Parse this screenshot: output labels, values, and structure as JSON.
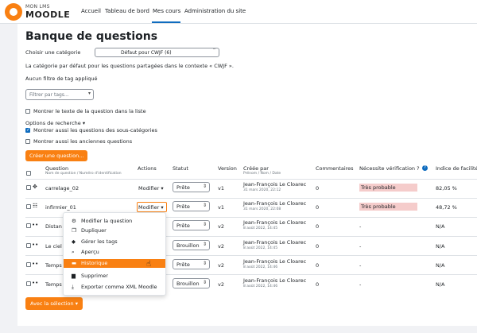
{
  "brand": {
    "top": "MON LMS",
    "main": "MOODLE",
    "accent": "#f98012"
  },
  "nav": {
    "items": [
      "Accueil",
      "Tableau de bord",
      "Mes cours",
      "Administration du site"
    ]
  },
  "page": {
    "title": "Banque de questions",
    "category_label": "Choisir une catégorie",
    "category_value": "Défaut pour CWJF (6)",
    "category_desc": "La catégorie par défaut pour les questions partagées dans le contexte « CWJF ».",
    "tag_status": "Aucun filtre de tag appliqué",
    "tag_placeholder": "Filtrer par tags...",
    "show_text": "Montrer le texte de la question dans la liste",
    "search_options": "Options de recherche",
    "show_subcats": "Montrer aussi les questions des sous-catégories",
    "show_old": "Montrer aussi les anciennes questions",
    "create_btn": "Créer une question..."
  },
  "table": {
    "headers": {
      "question": "Question",
      "question_sub": "Nom de question / Numéro d'identification",
      "actions": "Actions",
      "status": "Statut",
      "version": "Version",
      "created": "Créée par",
      "created_sub": "Prénom / Nom / Date",
      "comments": "Commentaires",
      "review": "Nécessite vérification ?",
      "facility": "Indice de facilité"
    },
    "rows": [
      {
        "icon": "✥",
        "name": "carrelage_02",
        "action": "Modifier",
        "status": "Prête",
        "version": "v1",
        "author": "Jean-François Le Cloarec",
        "date": "31 mars 2020, 22:12",
        "comments": "0",
        "review": "Très probable",
        "facility": "82,05 %"
      },
      {
        "icon": "☷",
        "name": "infirmier_01",
        "action": "Modifier",
        "status": "Prête",
        "version": "v1",
        "author": "Jean-François Le Cloarec",
        "date": "31 mars 2020, 22:08",
        "comments": "0",
        "review": "Très probable",
        "facility": "48,72 %"
      },
      {
        "icon": "••",
        "name": "Distan",
        "action": "",
        "status": "Prête",
        "version": "v2",
        "author": "Jean-François Le Cloarec",
        "date": "8 août 2022, 14:45",
        "comments": "0",
        "review": "-",
        "facility": "N/A"
      },
      {
        "icon": "••",
        "name": "Le ciel",
        "action": "",
        "status": "Brouillon",
        "version": "v2",
        "author": "Jean-François Le Cloarec",
        "date": "8 août 2022, 14:45",
        "comments": "0",
        "review": "-",
        "facility": "N/A"
      },
      {
        "icon": "••",
        "name": "Temps",
        "action": "",
        "status": "Prête",
        "version": "v2",
        "author": "Jean-François Le Cloarec",
        "date": "8 août 2022, 14:46",
        "comments": "0",
        "review": "-",
        "facility": "N/A"
      },
      {
        "icon": "••",
        "name": "Temps",
        "action": "",
        "status": "Brouillon",
        "version": "v2",
        "author": "Jean-François Le Cloarec",
        "date": "8 août 2022, 14:46",
        "comments": "0",
        "review": "-",
        "facility": "N/A"
      }
    ]
  },
  "menu": {
    "items": [
      {
        "icon": "gear-icon",
        "glyph": "⚙",
        "label": "Modifier la question"
      },
      {
        "icon": "copy-icon",
        "glyph": "❐",
        "label": "Dupliquer"
      },
      {
        "icon": "tag-icon",
        "glyph": "◆",
        "label": "Gérer les tags"
      },
      {
        "icon": "magnifier-icon",
        "glyph": "⌕",
        "label": "Aperçu"
      },
      {
        "icon": "history-icon",
        "glyph": "▬",
        "label": "Historique"
      },
      {
        "icon": "trash-icon",
        "glyph": "▆",
        "label": "Supprimer"
      },
      {
        "icon": "download-icon",
        "glyph": "⤓",
        "label": "Exporter comme XML Moodle"
      }
    ],
    "active_index": 4
  },
  "bulk_btn": "Avec la sélection"
}
